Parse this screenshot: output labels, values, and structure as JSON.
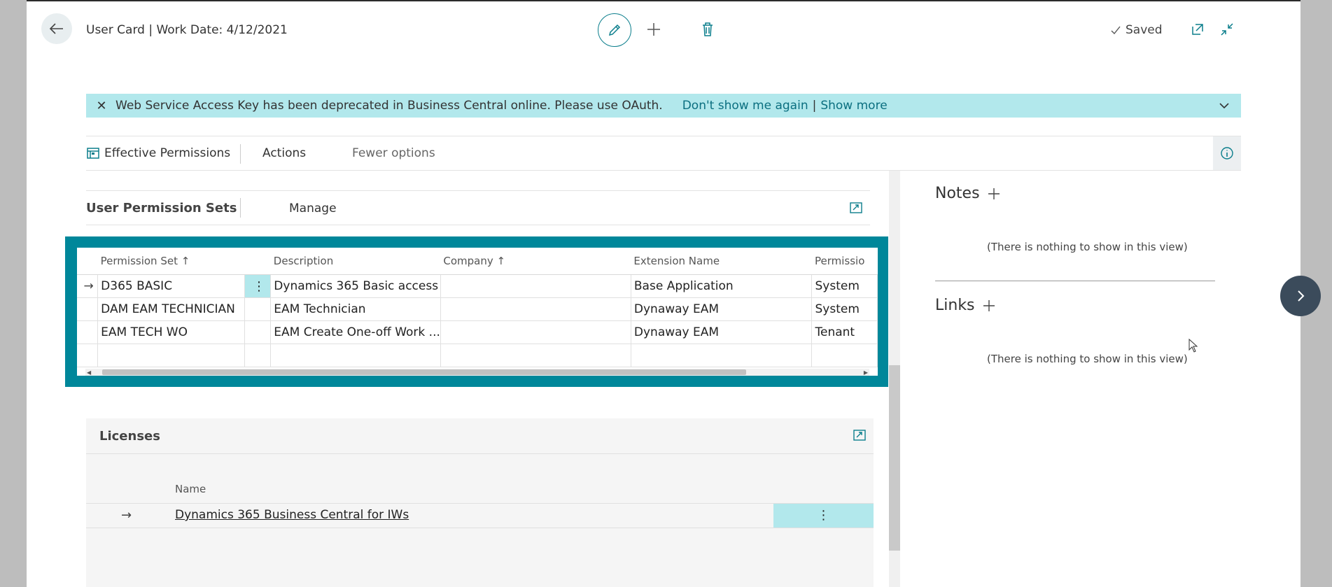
{
  "header": {
    "title": "User Card | Work Date: 4/12/2021",
    "saved_label": "Saved"
  },
  "banner": {
    "message": "Web Service Access Key has been deprecated in Business Central online. Please use OAuth.",
    "dont_show": "Don't show me again",
    "separator": "|",
    "show_more": "Show more"
  },
  "actionbar": {
    "effective_permissions": "Effective Permissions",
    "actions": "Actions",
    "fewer_options": "Fewer options"
  },
  "permission_sets": {
    "title": "User Permission Sets",
    "manage": "Manage",
    "columns": [
      "Permission Set",
      "Description",
      "Company",
      "Extension Name",
      "Permissio"
    ],
    "sort_marks": [
      "↑",
      "",
      "↑",
      "",
      ""
    ],
    "rows": [
      {
        "set": "D365 BASIC",
        "description": "Dynamics 365 Basic access",
        "company": "",
        "extension": "Base Application",
        "scope": "System"
      },
      {
        "set": "DAM EAM TECHNICIAN",
        "description": "EAM Technician",
        "company": "",
        "extension": "Dynaway EAM",
        "scope": "System"
      },
      {
        "set": "EAM TECH WO",
        "description": "EAM Create One-off Work ...",
        "company": "",
        "extension": "Dynaway EAM",
        "scope": "Tenant"
      }
    ]
  },
  "licenses": {
    "title": "Licenses",
    "column": "Name",
    "rows": [
      {
        "name": "Dynamics 365 Business Central for IWs"
      }
    ]
  },
  "factbox": {
    "notes_title": "Notes",
    "notes_empty": "(There is nothing to show in this view)",
    "links_title": "Links",
    "links_empty": "(There is nothing to show in this view)"
  },
  "colors": {
    "accent": "#00879a",
    "banner": "#b2e8ec",
    "link": "#0b6f80"
  }
}
